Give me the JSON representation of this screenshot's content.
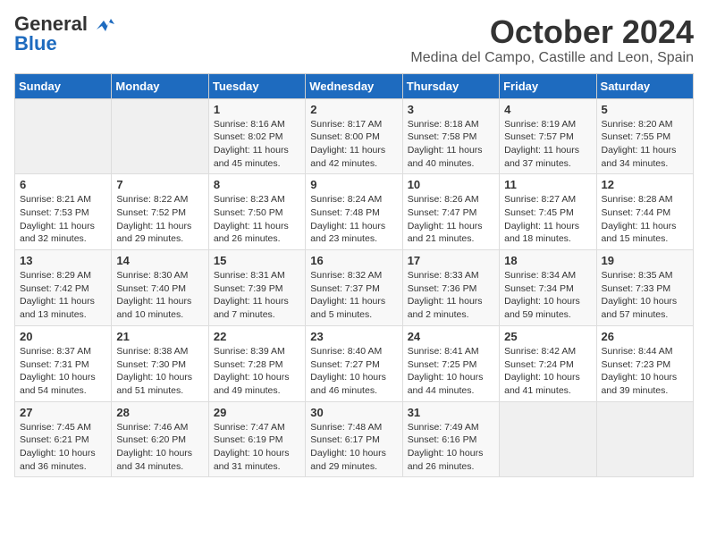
{
  "logo": {
    "line1": "General",
    "line2": "Blue"
  },
  "title": "October 2024",
  "location": "Medina del Campo, Castille and Leon, Spain",
  "days_of_week": [
    "Sunday",
    "Monday",
    "Tuesday",
    "Wednesday",
    "Thursday",
    "Friday",
    "Saturday"
  ],
  "weeks": [
    [
      {
        "day": "",
        "info": ""
      },
      {
        "day": "",
        "info": ""
      },
      {
        "day": "1",
        "info": "Sunrise: 8:16 AM\nSunset: 8:02 PM\nDaylight: 11 hours and 45 minutes."
      },
      {
        "day": "2",
        "info": "Sunrise: 8:17 AM\nSunset: 8:00 PM\nDaylight: 11 hours and 42 minutes."
      },
      {
        "day": "3",
        "info": "Sunrise: 8:18 AM\nSunset: 7:58 PM\nDaylight: 11 hours and 40 minutes."
      },
      {
        "day": "4",
        "info": "Sunrise: 8:19 AM\nSunset: 7:57 PM\nDaylight: 11 hours and 37 minutes."
      },
      {
        "day": "5",
        "info": "Sunrise: 8:20 AM\nSunset: 7:55 PM\nDaylight: 11 hours and 34 minutes."
      }
    ],
    [
      {
        "day": "6",
        "info": "Sunrise: 8:21 AM\nSunset: 7:53 PM\nDaylight: 11 hours and 32 minutes."
      },
      {
        "day": "7",
        "info": "Sunrise: 8:22 AM\nSunset: 7:52 PM\nDaylight: 11 hours and 29 minutes."
      },
      {
        "day": "8",
        "info": "Sunrise: 8:23 AM\nSunset: 7:50 PM\nDaylight: 11 hours and 26 minutes."
      },
      {
        "day": "9",
        "info": "Sunrise: 8:24 AM\nSunset: 7:48 PM\nDaylight: 11 hours and 23 minutes."
      },
      {
        "day": "10",
        "info": "Sunrise: 8:26 AM\nSunset: 7:47 PM\nDaylight: 11 hours and 21 minutes."
      },
      {
        "day": "11",
        "info": "Sunrise: 8:27 AM\nSunset: 7:45 PM\nDaylight: 11 hours and 18 minutes."
      },
      {
        "day": "12",
        "info": "Sunrise: 8:28 AM\nSunset: 7:44 PM\nDaylight: 11 hours and 15 minutes."
      }
    ],
    [
      {
        "day": "13",
        "info": "Sunrise: 8:29 AM\nSunset: 7:42 PM\nDaylight: 11 hours and 13 minutes."
      },
      {
        "day": "14",
        "info": "Sunrise: 8:30 AM\nSunset: 7:40 PM\nDaylight: 11 hours and 10 minutes."
      },
      {
        "day": "15",
        "info": "Sunrise: 8:31 AM\nSunset: 7:39 PM\nDaylight: 11 hours and 7 minutes."
      },
      {
        "day": "16",
        "info": "Sunrise: 8:32 AM\nSunset: 7:37 PM\nDaylight: 11 hours and 5 minutes."
      },
      {
        "day": "17",
        "info": "Sunrise: 8:33 AM\nSunset: 7:36 PM\nDaylight: 11 hours and 2 minutes."
      },
      {
        "day": "18",
        "info": "Sunrise: 8:34 AM\nSunset: 7:34 PM\nDaylight: 10 hours and 59 minutes."
      },
      {
        "day": "19",
        "info": "Sunrise: 8:35 AM\nSunset: 7:33 PM\nDaylight: 10 hours and 57 minutes."
      }
    ],
    [
      {
        "day": "20",
        "info": "Sunrise: 8:37 AM\nSunset: 7:31 PM\nDaylight: 10 hours and 54 minutes."
      },
      {
        "day": "21",
        "info": "Sunrise: 8:38 AM\nSunset: 7:30 PM\nDaylight: 10 hours and 51 minutes."
      },
      {
        "day": "22",
        "info": "Sunrise: 8:39 AM\nSunset: 7:28 PM\nDaylight: 10 hours and 49 minutes."
      },
      {
        "day": "23",
        "info": "Sunrise: 8:40 AM\nSunset: 7:27 PM\nDaylight: 10 hours and 46 minutes."
      },
      {
        "day": "24",
        "info": "Sunrise: 8:41 AM\nSunset: 7:25 PM\nDaylight: 10 hours and 44 minutes."
      },
      {
        "day": "25",
        "info": "Sunrise: 8:42 AM\nSunset: 7:24 PM\nDaylight: 10 hours and 41 minutes."
      },
      {
        "day": "26",
        "info": "Sunrise: 8:44 AM\nSunset: 7:23 PM\nDaylight: 10 hours and 39 minutes."
      }
    ],
    [
      {
        "day": "27",
        "info": "Sunrise: 7:45 AM\nSunset: 6:21 PM\nDaylight: 10 hours and 36 minutes."
      },
      {
        "day": "28",
        "info": "Sunrise: 7:46 AM\nSunset: 6:20 PM\nDaylight: 10 hours and 34 minutes."
      },
      {
        "day": "29",
        "info": "Sunrise: 7:47 AM\nSunset: 6:19 PM\nDaylight: 10 hours and 31 minutes."
      },
      {
        "day": "30",
        "info": "Sunrise: 7:48 AM\nSunset: 6:17 PM\nDaylight: 10 hours and 29 minutes."
      },
      {
        "day": "31",
        "info": "Sunrise: 7:49 AM\nSunset: 6:16 PM\nDaylight: 10 hours and 26 minutes."
      },
      {
        "day": "",
        "info": ""
      },
      {
        "day": "",
        "info": ""
      }
    ]
  ]
}
